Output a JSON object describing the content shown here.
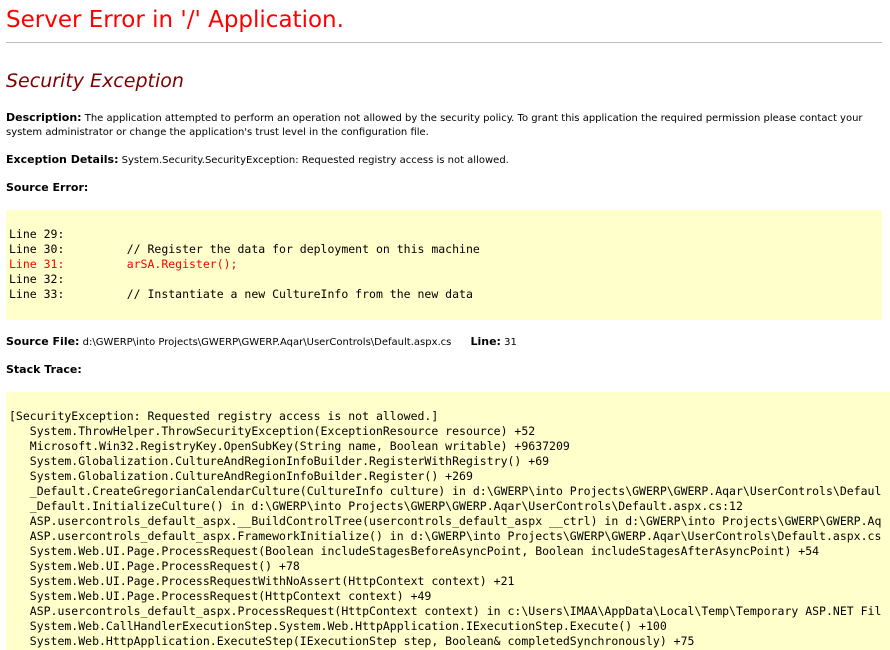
{
  "colors": {
    "title": "#ff0000",
    "section_title": "#800000",
    "code_background": "#ffffcc",
    "error_line": "#ff0000",
    "rule": "#c0c0c0"
  },
  "page": {
    "title": "Server Error in '/' Application."
  },
  "section": {
    "title": "Security Exception"
  },
  "description": {
    "label": "Description:",
    "text": " The application attempted to perform an operation not allowed by the security policy.  To grant this application the required permission please contact your system administrator or change the application's trust level in the configuration file."
  },
  "exception_details": {
    "label": "Exception Details:",
    "text": " System.Security.SecurityException: Requested registry access is not allowed."
  },
  "source_error": {
    "heading": "Source Error:",
    "lines": [
      {
        "text": "Line 29:",
        "highlight": false
      },
      {
        "text": "Line 30:         // Register the data for deployment on this machine",
        "highlight": false
      },
      {
        "text": "Line 31:         arSA.Register();",
        "highlight": true
      },
      {
        "text": "Line 32:",
        "highlight": false
      },
      {
        "text": "Line 33:         // Instantiate a new CultureInfo from the new data",
        "highlight": false
      }
    ]
  },
  "source_file": {
    "label": "Source File:",
    "path": " d:\\GWERP\\into Projects\\GWERP\\GWERP.Aqar\\UserControls\\Default.aspx.cs",
    "line_label": "Line:",
    "line_number": " 31"
  },
  "stack_trace": {
    "heading": "Stack Trace:",
    "lines": [
      "[SecurityException: Requested registry access is not allowed.]",
      "   System.ThrowHelper.ThrowSecurityException(ExceptionResource resource) +52",
      "   Microsoft.Win32.RegistryKey.OpenSubKey(String name, Boolean writable) +9637209",
      "   System.Globalization.CultureAndRegionInfoBuilder.RegisterWithRegistry() +69",
      "   System.Globalization.CultureAndRegionInfoBuilder.Register() +269",
      "   _Default.CreateGregorianCalendarCulture(CultureInfo culture) in d:\\GWERP\\into Projects\\GWERP\\GWERP.Aqar\\UserControls\\Defaul",
      "   _Default.InitializeCulture() in d:\\GWERP\\into Projects\\GWERP\\GWERP.Aqar\\UserControls\\Default.aspx.cs:12",
      "   ASP.usercontrols_default_aspx.__BuildControlTree(usercontrols_default_aspx __ctrl) in d:\\GWERP\\into Projects\\GWERP\\GWERP.Aq",
      "   ASP.usercontrols_default_aspx.FrameworkInitialize() in d:\\GWERP\\into Projects\\GWERP\\GWERP.Aqar\\UserControls\\Default.aspx.cs",
      "   System.Web.UI.Page.ProcessRequest(Boolean includeStagesBeforeAsyncPoint, Boolean includeStagesAfterAsyncPoint) +54",
      "   System.Web.UI.Page.ProcessRequest() +78",
      "   System.Web.UI.Page.ProcessRequestWithNoAssert(HttpContext context) +21",
      "   System.Web.UI.Page.ProcessRequest(HttpContext context) +49",
      "   ASP.usercontrols_default_aspx.ProcessRequest(HttpContext context) in c:\\Users\\IMAA\\AppData\\Local\\Temp\\Temporary ASP.NET Fil",
      "   System.Web.CallHandlerExecutionStep.System.Web.HttpApplication.IExecutionStep.Execute() +100",
      "   System.Web.HttpApplication.ExecuteStep(IExecutionStep step, Boolean& completedSynchronously) +75"
    ]
  }
}
